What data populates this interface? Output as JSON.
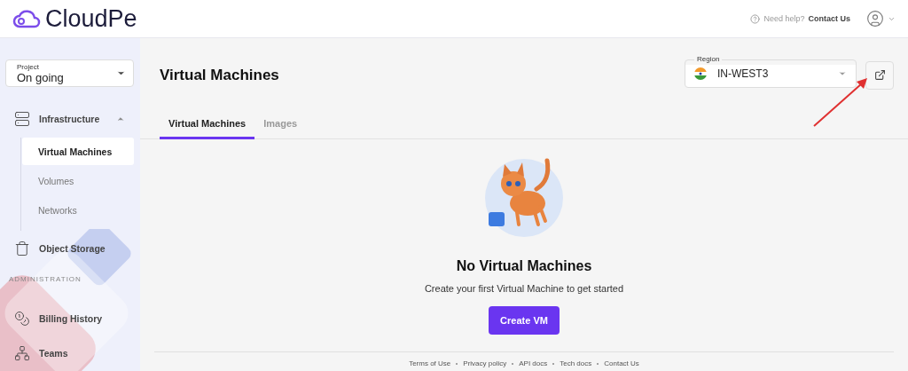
{
  "header": {
    "logo": "CloudPe",
    "help_prefix": "Need help?",
    "help_link": "Contact Us"
  },
  "sidebar": {
    "project": {
      "label": "Project",
      "value": "On going"
    },
    "items": [
      {
        "kind": "group",
        "label": "Infrastructure",
        "expanded": true,
        "children": [
          {
            "label": "Virtual Machines",
            "selected": true
          },
          {
            "label": "Volumes",
            "selected": false
          },
          {
            "label": "Networks",
            "selected": false
          }
        ]
      },
      {
        "kind": "item",
        "label": "Object Storage"
      },
      {
        "kind": "section",
        "label": "ADMINISTRATION"
      },
      {
        "kind": "item",
        "label": "Billing History"
      },
      {
        "kind": "item",
        "label": "Teams"
      }
    ]
  },
  "main": {
    "title": "Virtual Machines",
    "region": {
      "label": "Region",
      "value": "IN-WEST3"
    },
    "tabs": [
      {
        "label": "Virtual Machines",
        "selected": true
      },
      {
        "label": "Images",
        "selected": false
      }
    ],
    "empty_state": {
      "title": "No Virtual Machines",
      "text": "Create your first Virtual Machine to get started",
      "button": "Create VM"
    },
    "footer_links": [
      "Terms of Use",
      "Privacy policy",
      "API docs",
      "Tech docs",
      "Contact Us"
    ]
  }
}
